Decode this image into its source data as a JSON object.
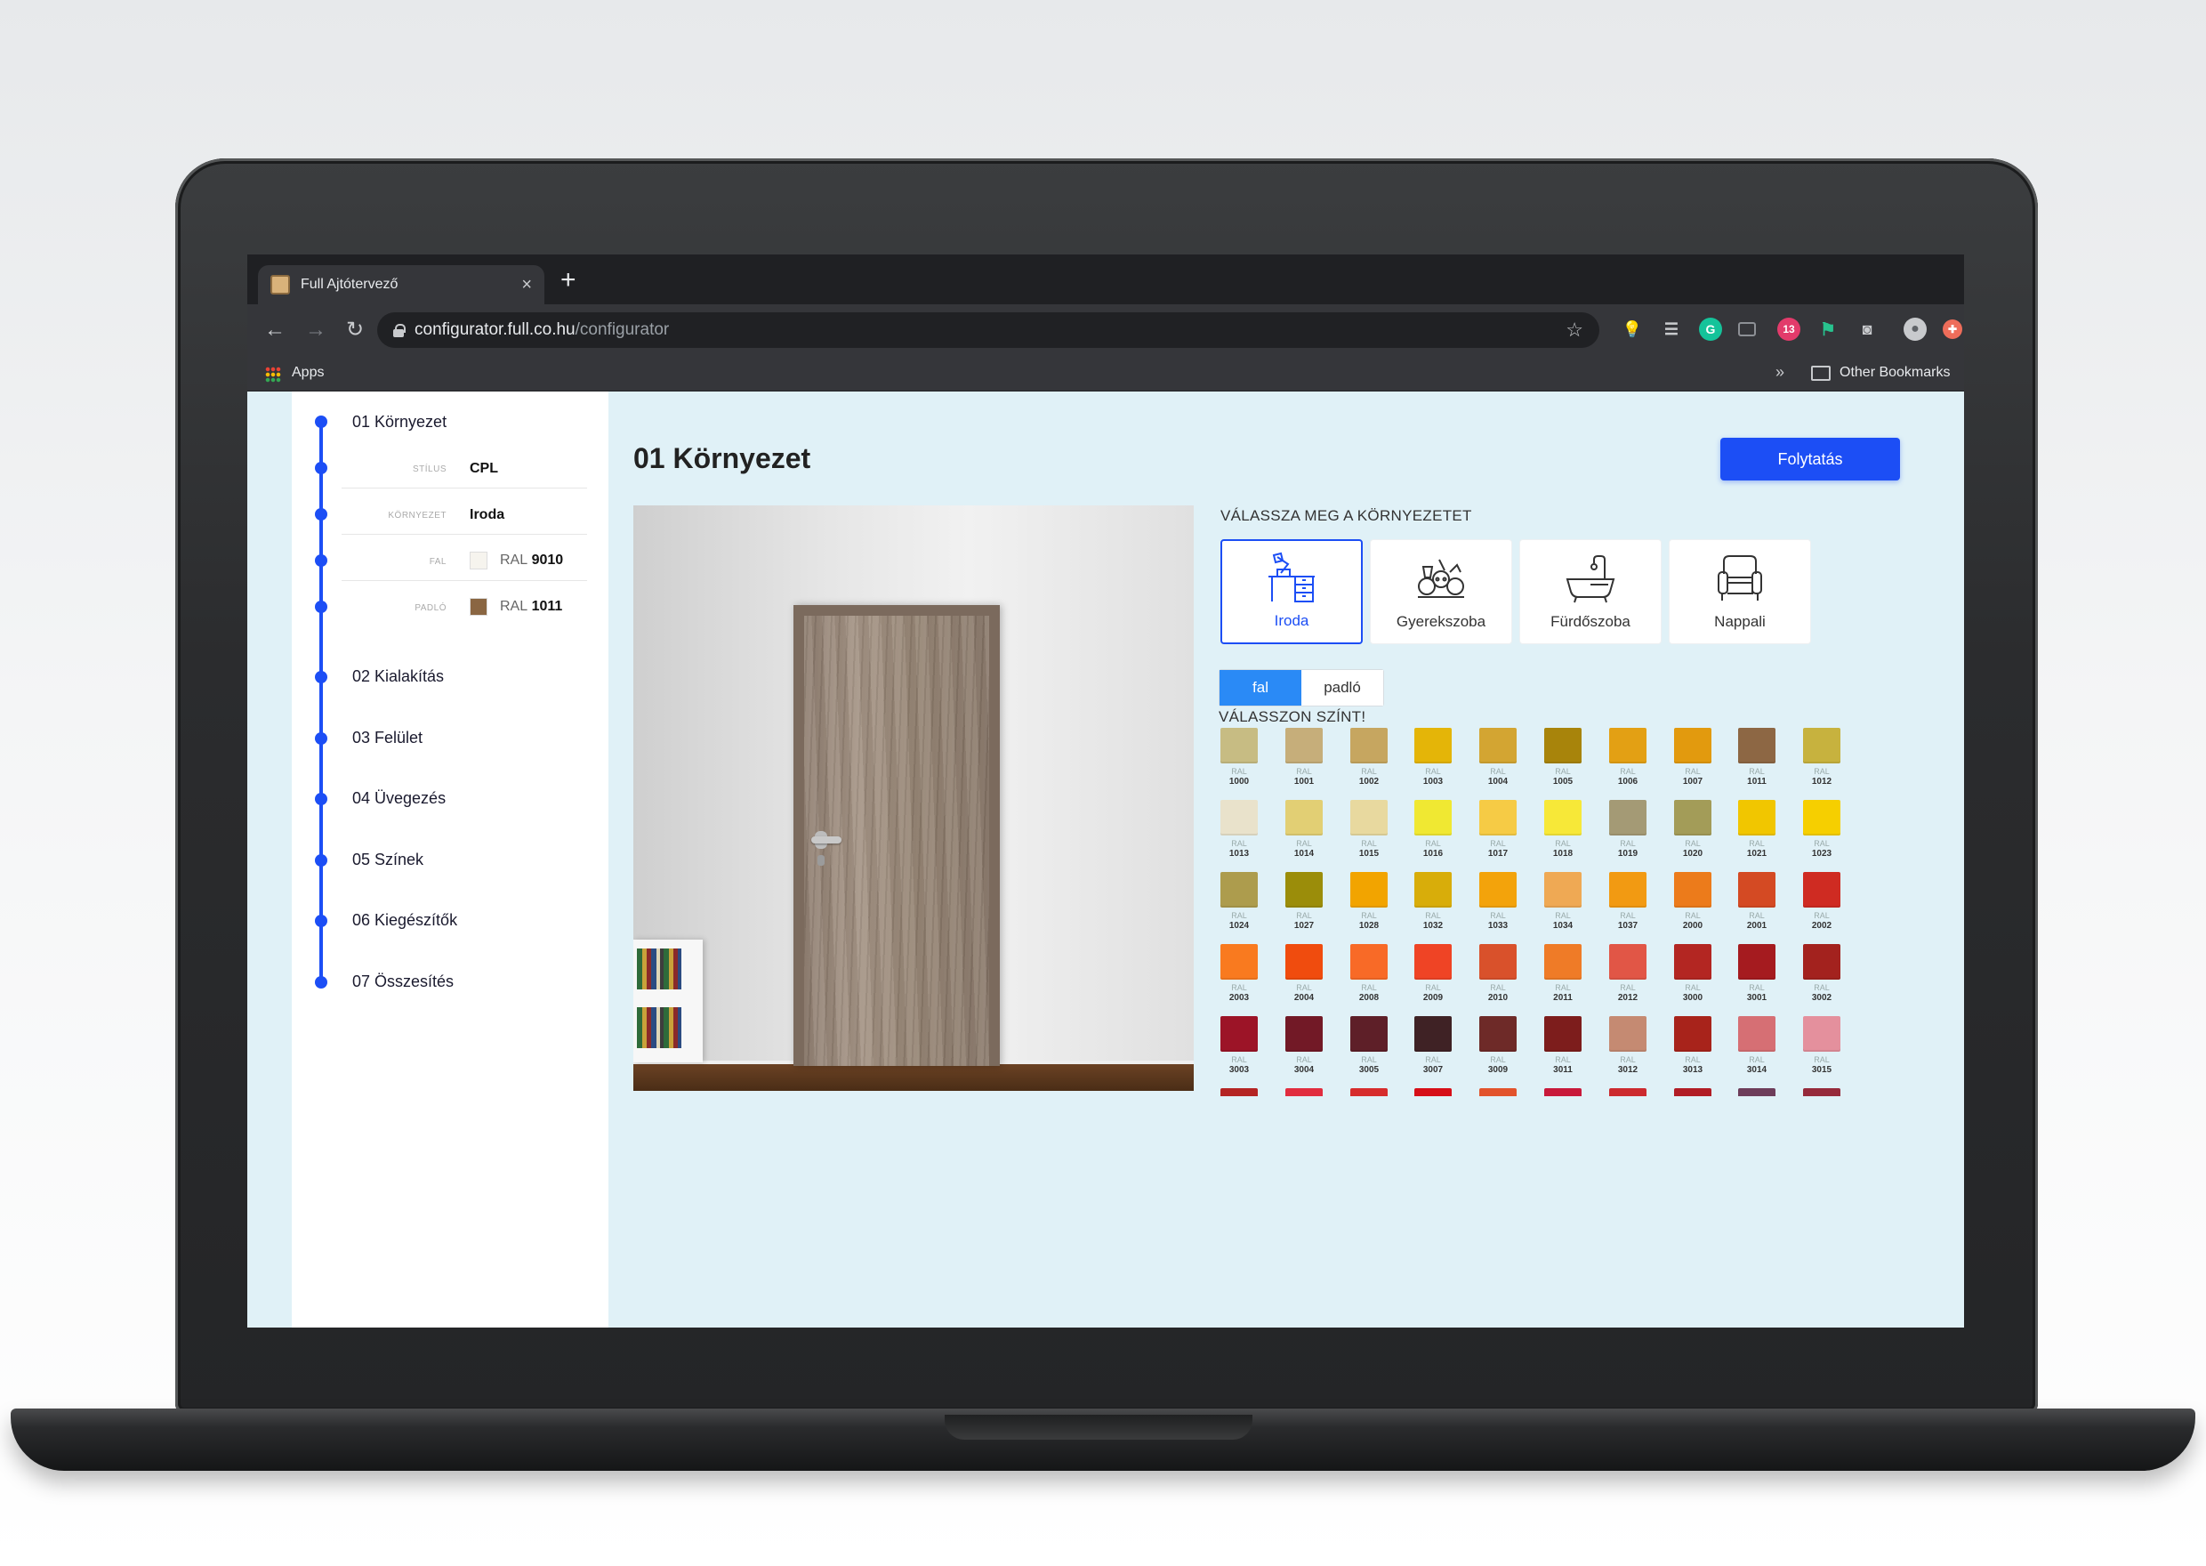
{
  "browser": {
    "tab_title": "Full Ajtótervező",
    "tab_close": "×",
    "new_tab": "+",
    "url_host": "configurator.full.co.hu",
    "url_path": "/configurator",
    "bookmarks_apps": "Apps",
    "bookmarks_more": "»",
    "other_bookmarks": "Other Bookmarks",
    "extension_badge": "13"
  },
  "sidebar": {
    "steps": [
      {
        "label": "01 Környezet"
      },
      {
        "label": "02 Kialakítás"
      },
      {
        "label": "03 Felület"
      },
      {
        "label": "04 Üvegezés"
      },
      {
        "label": "05 Színek"
      },
      {
        "label": "06 Kiegészítők"
      },
      {
        "label": "07 Összesítés"
      }
    ],
    "details": {
      "stilus_label": "STÍLUS",
      "stilus_value": "CPL",
      "kornyezet_label": "KÖRNYEZET",
      "kornyezet_value": "Iroda",
      "fal_label": "FAL",
      "fal_prefix": "RAL",
      "fal_code": "9010",
      "fal_color": "#f6f4ee",
      "padlo_label": "PADLÓ",
      "padlo_prefix": "RAL",
      "padlo_code": "1011",
      "padlo_color": "#8a6642"
    }
  },
  "main": {
    "title": "01 Környezet",
    "continue_button": "Folytatás",
    "env_heading": "VÁLASSZA MEG A KÖRNYEZETET",
    "environments": [
      {
        "label": "Iroda",
        "icon": "desk-lamp-icon",
        "selected": true
      },
      {
        "label": "Gyerekszoba",
        "icon": "toys-icon",
        "selected": false
      },
      {
        "label": "Fürdőszoba",
        "icon": "bathtub-icon",
        "selected": false
      },
      {
        "label": "Nappali",
        "icon": "armchair-icon",
        "selected": false
      }
    ],
    "toggle": {
      "wall": "fal",
      "floor": "padló",
      "active": "fal"
    },
    "color_heading": "VÁLASSZON SZÍNT!",
    "ral_prefix": "RAL",
    "swatches": [
      {
        "code": "1000",
        "color": "#c7bc83"
      },
      {
        "code": "1001",
        "color": "#c6ae7a"
      },
      {
        "code": "1002",
        "color": "#c6a660"
      },
      {
        "code": "1003",
        "color": "#e4b508"
      },
      {
        "code": "1004",
        "color": "#d3a532"
      },
      {
        "code": "1005",
        "color": "#a8840b"
      },
      {
        "code": "1006",
        "color": "#e3a014"
      },
      {
        "code": "1007",
        "color": "#e29a0e"
      },
      {
        "code": "1011",
        "color": "#8d6744"
      },
      {
        "code": "1012",
        "color": "#c7b23e"
      },
      {
        "code": "1013",
        "color": "#e9e2cb"
      },
      {
        "code": "1014",
        "color": "#e2cf74"
      },
      {
        "code": "1015",
        "color": "#e8d99f"
      },
      {
        "code": "1016",
        "color": "#f0e832"
      },
      {
        "code": "1017",
        "color": "#f6cb45"
      },
      {
        "code": "1018",
        "color": "#f7e838"
      },
      {
        "code": "1019",
        "color": "#a49a75"
      },
      {
        "code": "1020",
        "color": "#a39c58"
      },
      {
        "code": "1021",
        "color": "#f1c600"
      },
      {
        "code": "1023",
        "color": "#f6cf00"
      },
      {
        "code": "1024",
        "color": "#ad9c4d"
      },
      {
        "code": "1027",
        "color": "#9b8d0a"
      },
      {
        "code": "1028",
        "color": "#f2a400"
      },
      {
        "code": "1032",
        "color": "#d8ad0a"
      },
      {
        "code": "1033",
        "color": "#f3a30b"
      },
      {
        "code": "1034",
        "color": "#efa954"
      },
      {
        "code": "1037",
        "color": "#f29a12"
      },
      {
        "code": "2000",
        "color": "#ec7b1b"
      },
      {
        "code": "2001",
        "color": "#d44a23"
      },
      {
        "code": "2002",
        "color": "#cf2b22"
      },
      {
        "code": "2003",
        "color": "#f97a1f"
      },
      {
        "code": "2004",
        "color": "#f04c0e"
      },
      {
        "code": "2008",
        "color": "#f86a27"
      },
      {
        "code": "2009",
        "color": "#ef4425"
      },
      {
        "code": "2010",
        "color": "#d9512b"
      },
      {
        "code": "2011",
        "color": "#ef7b27"
      },
      {
        "code": "2012",
        "color": "#e15646"
      },
      {
        "code": "3000",
        "color": "#b32622"
      },
      {
        "code": "3001",
        "color": "#a51b1f"
      },
      {
        "code": "3002",
        "color": "#a3221e"
      },
      {
        "code": "3003",
        "color": "#9c1427"
      },
      {
        "code": "3004",
        "color": "#721926"
      },
      {
        "code": "3005",
        "color": "#5e1f28"
      },
      {
        "code": "3007",
        "color": "#3f2225"
      },
      {
        "code": "3009",
        "color": "#6e2a28"
      },
      {
        "code": "3011",
        "color": "#7d1d1c"
      },
      {
        "code": "3012",
        "color": "#c58a72"
      },
      {
        "code": "3013",
        "color": "#a8231b"
      },
      {
        "code": "3014",
        "color": "#d66f74"
      },
      {
        "code": "3015",
        "color": "#e4909d"
      },
      {
        "code": "",
        "color": "#b42423"
      },
      {
        "code": "",
        "color": "#e12d3f"
      },
      {
        "code": "",
        "color": "#d62c2c"
      },
      {
        "code": "",
        "color": "#d60f18"
      },
      {
        "code": "",
        "color": "#e2532c"
      },
      {
        "code": "",
        "color": "#c8193a"
      },
      {
        "code": "",
        "color": "#cc2a2e"
      },
      {
        "code": "",
        "color": "#b11d25"
      },
      {
        "code": "",
        "color": "#6d3d5a"
      },
      {
        "code": "",
        "color": "#962a3b"
      }
    ]
  },
  "colors": {
    "accent": "#1c4ef5",
    "toggle_active": "#2a8af6",
    "page_bg": "#e0f1f7"
  }
}
